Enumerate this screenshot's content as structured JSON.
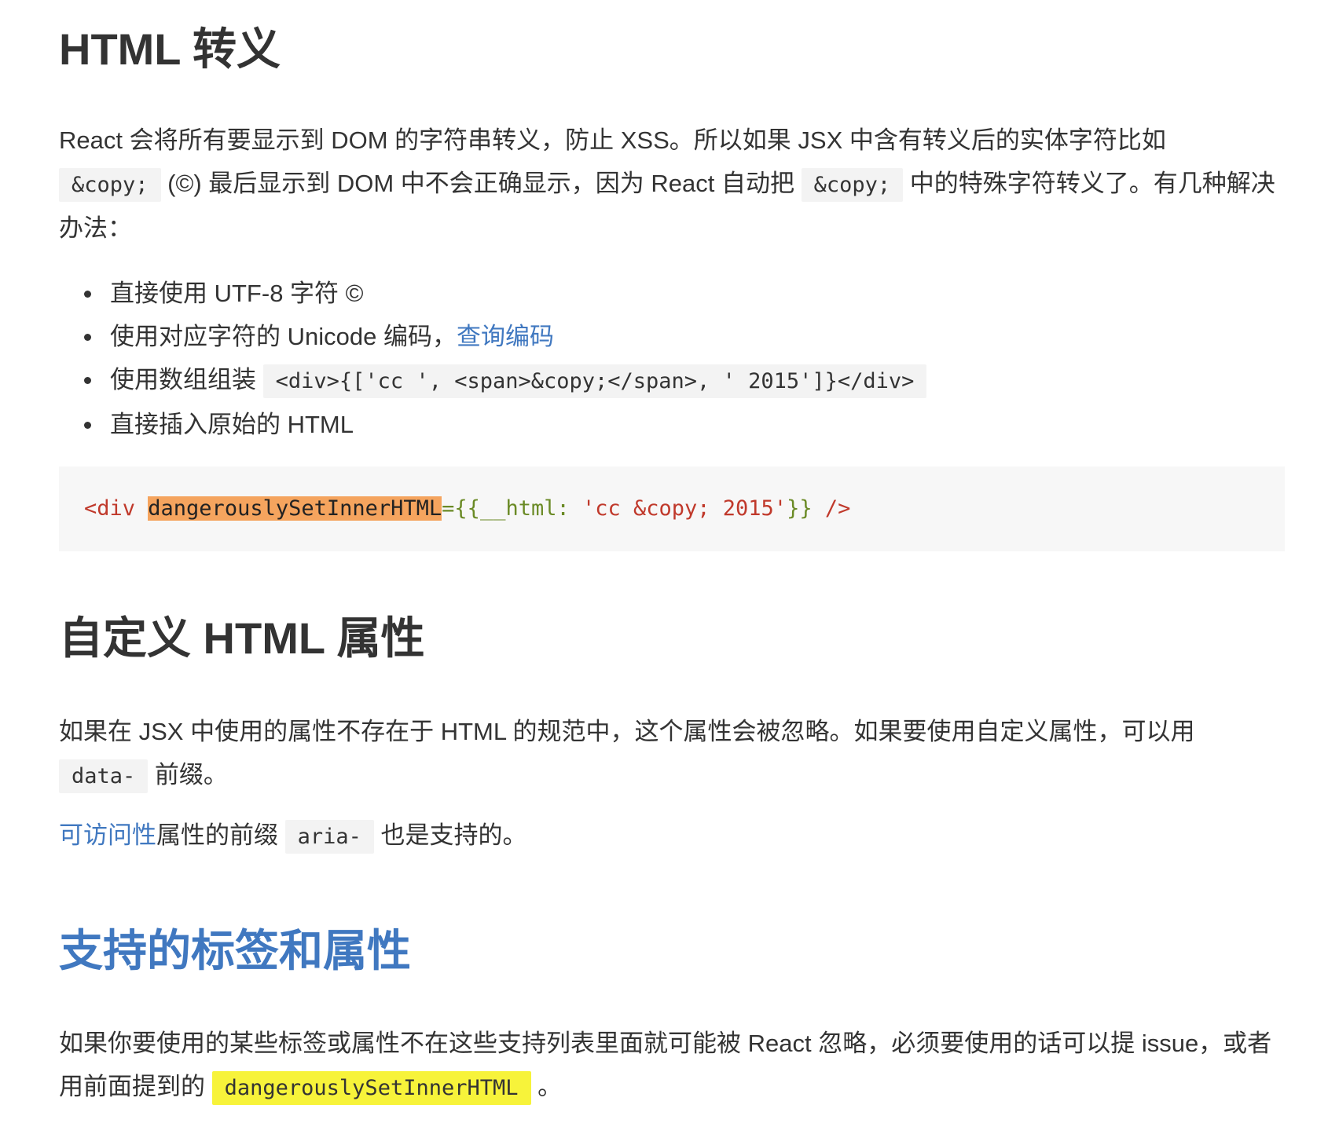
{
  "sections": {
    "escape": {
      "title": "HTML 转义",
      "para1": {
        "text_a": "React 会将所有要显示到 DOM 的字符串转义，防止 XSS。所以如果 JSX 中含有转义后的实体字符比如",
        "code_a": "&copy;",
        "text_b": " (©) 最后显示到 DOM 中不会正确显示，因为 React 自动把 ",
        "code_b": "&copy;",
        "text_c": " 中的特殊字符转义了。有几种解决办法："
      },
      "list": {
        "item1": "直接使用 UTF-8 字符 ©",
        "item2_text": "使用对应字符的 Unicode 编码，",
        "item2_link": "查询编码",
        "item3_text": "使用数组组装 ",
        "item3_code": "<div>{['cc ', <span>&copy;</span>, ' 2015']}</div>",
        "item4": "直接插入原始的 HTML"
      },
      "code_block": {
        "tag_open": "<div ",
        "attr": "dangerouslySetInnerHTML",
        "eq_braces": "={{",
        "key": "__html: ",
        "value": "'cc &copy; 2015'",
        "close_braces": "}}",
        "tag_close": " />"
      }
    },
    "custom_attrs": {
      "title": "自定义 HTML 属性",
      "para1": {
        "text_a": "如果在 JSX 中使用的属性不存在于 HTML 的规范中，这个属性会被忽略。如果要使用自定义属性，可以用",
        "code": "data-",
        "text_b": " 前缀。"
      },
      "para2": {
        "link": "可访问性",
        "text_a": "属性的前缀 ",
        "code": "aria-",
        "text_b": " 也是支持的。"
      }
    },
    "supported": {
      "title": "支持的标签和属性",
      "para1": {
        "text_a": "如果你要使用的某些标签或属性不在这些支持列表里面就可能被 React 忽略，必须要使用的话可以提 issue，或者用前面提到的 ",
        "code": "dangerouslySetInnerHTML",
        "text_b": " 。"
      }
    }
  },
  "colors": {
    "heading": "#333333",
    "link": "#4078c0",
    "code_bg": "#f3f3f3",
    "highlight_yellow": "#f7f33a",
    "highlight_orange": "#f5a45e"
  }
}
